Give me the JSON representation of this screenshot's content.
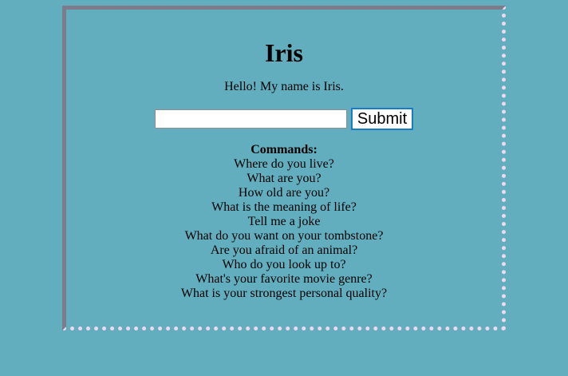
{
  "page": {
    "title": "Iris",
    "greeting": "Hello! My name is Iris."
  },
  "form": {
    "input_value": "",
    "submit_label": "Submit"
  },
  "commands": {
    "heading": "Commands:",
    "items": [
      "Where do you live?",
      "What are you?",
      "How old are you?",
      "What is the meaning of life?",
      "Tell me a joke",
      "What do you want on your tombstone?",
      "Are you afraid of an animal?",
      "Who do you look up to?",
      "What's your favorite movie genre?",
      "What is your strongest personal quality?"
    ]
  },
  "colors": {
    "background": "#62aebe",
    "frame_solid_border": "#7e7b8c",
    "frame_dotted_border": "#f0d9f0",
    "submit_border": "#1b7bc4"
  }
}
